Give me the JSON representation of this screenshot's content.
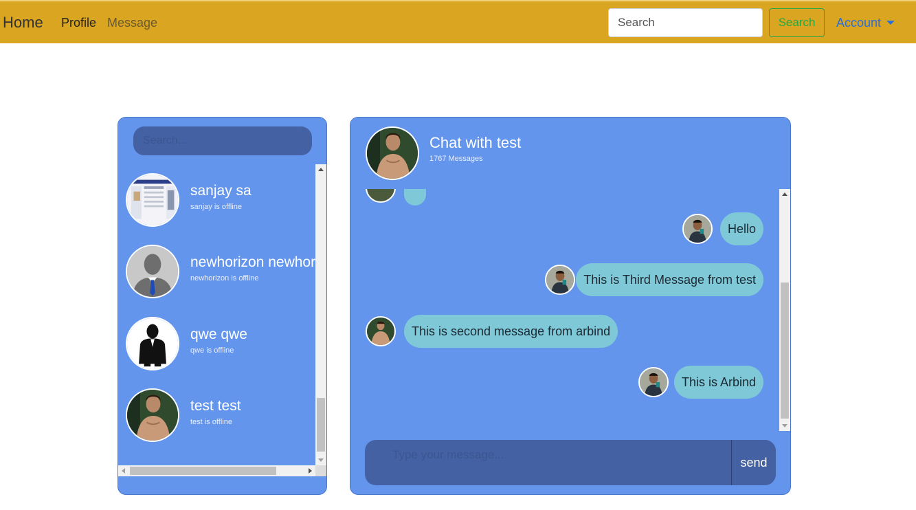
{
  "navbar": {
    "brand": "Home",
    "links": [
      {
        "label": "Profile"
      },
      {
        "label": "Message"
      }
    ],
    "search_placeholder": "Search",
    "search_button": "Search",
    "account_label": "Account",
    "colors": {
      "background": "#DAA520",
      "search_button": "#28a745",
      "account": "#2a6fd8"
    }
  },
  "sidebar": {
    "search_placeholder": "Search...",
    "contacts": [
      {
        "name": "sanjay sa",
        "status": "sanjay is offline",
        "avatar": "screenshot-thumbnail"
      },
      {
        "name": "newhorizon newhorizon",
        "status": "newhorizon is offline",
        "avatar": "default-user-silhouette-icon"
      },
      {
        "name": "qwe qwe",
        "status": "qwe is offline",
        "avatar": "businessman-silhouette-icon"
      },
      {
        "name": "test test",
        "status": "test is offline",
        "avatar": "profile-photo"
      }
    ]
  },
  "chat": {
    "title": "Chat with test",
    "message_count": "1767 Messages",
    "messages": [
      {
        "text": "Hello",
        "side": "right",
        "sender": "arbind"
      },
      {
        "text": "This is Third Message from test",
        "side": "right",
        "sender": "arbind"
      },
      {
        "text": "This is second message from arbind",
        "side": "left",
        "sender": "test"
      },
      {
        "text": "This is Arbind",
        "side": "right",
        "sender": "arbind"
      }
    ],
    "compose_placeholder": "Type your message...",
    "send_label": "send",
    "colors": {
      "panel": "#6495ED",
      "bubble": "#7ec8d8",
      "compose": "#4462a3"
    }
  }
}
